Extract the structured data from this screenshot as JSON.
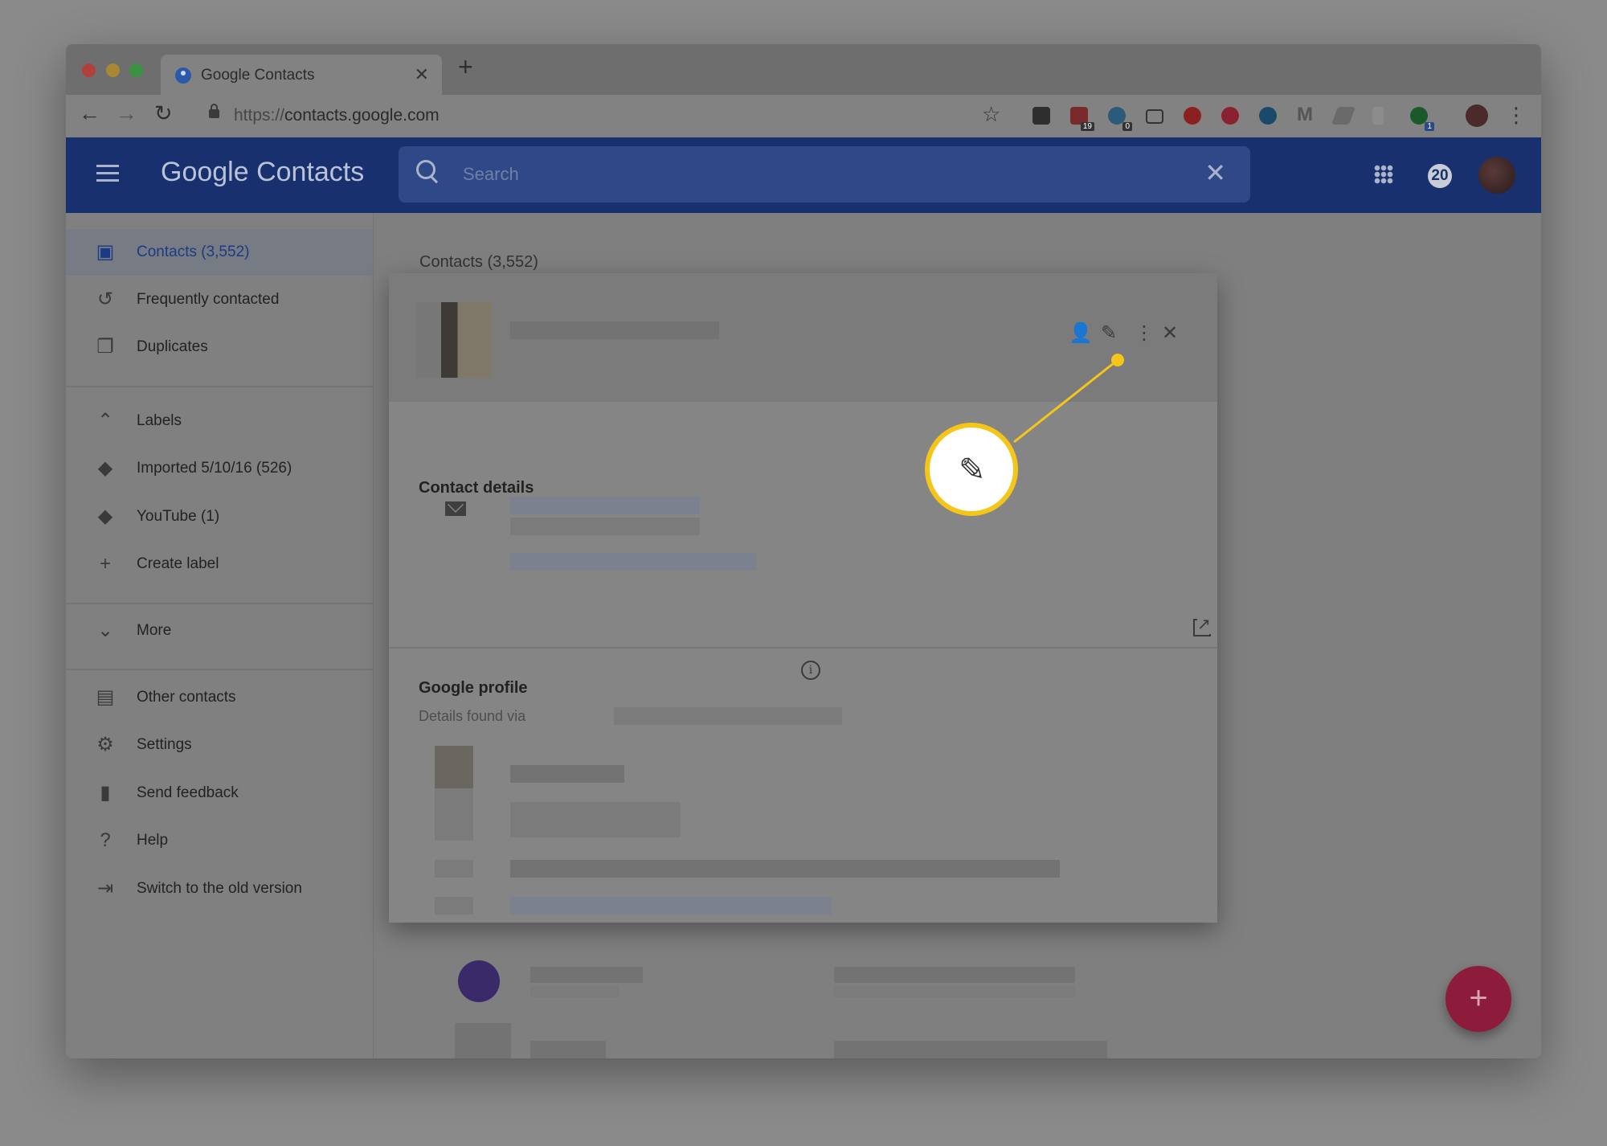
{
  "browser": {
    "tab_title": "Google Contacts",
    "tab_close": "✕",
    "new_tab": "+",
    "url_scheme": "https://",
    "url_host": "contacts.google.com",
    "extension_badges": [
      "19",
      "0",
      "1"
    ]
  },
  "app": {
    "logo": "Google Contacts",
    "search_placeholder": "Search",
    "notification_count": "20"
  },
  "sidebar": {
    "items": [
      {
        "label": "Contacts (3,552)",
        "icon": "contacts-icon",
        "active": true
      },
      {
        "label": "Frequently contacted",
        "icon": "history-icon"
      },
      {
        "label": "Duplicates",
        "icon": "duplicates-icon"
      },
      {
        "label": "Labels",
        "icon": "chevron-up-icon"
      },
      {
        "label": "Imported 5/10/16 (526)",
        "icon": "label-icon"
      },
      {
        "label": "YouTube (1)",
        "icon": "label-icon"
      },
      {
        "label": "Create label",
        "icon": "plus-icon"
      },
      {
        "label": "More",
        "icon": "chevron-down-icon"
      },
      {
        "label": "Other contacts",
        "icon": "archive-icon"
      },
      {
        "label": "Settings",
        "icon": "gear-icon"
      },
      {
        "label": "Send feedback",
        "icon": "feedback-icon"
      },
      {
        "label": "Help",
        "icon": "help-icon"
      },
      {
        "label": "Switch to the old version",
        "icon": "exit-icon"
      }
    ]
  },
  "main": {
    "title": "Contacts (3,552)"
  },
  "card": {
    "contact_details_title": "Contact details",
    "google_profile_title": "Google profile",
    "details_found_via": "Details found via"
  },
  "colors": {
    "callout": "#f5c518",
    "fab": "#8d1b3c",
    "appbar": "#18306e"
  }
}
